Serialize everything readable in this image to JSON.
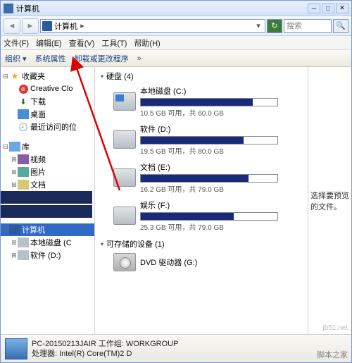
{
  "title": "计算机",
  "address": "计算机",
  "search_placeholder": "搜索",
  "menus": {
    "file": "文件(F)",
    "edit": "编辑(E)",
    "view": "查看(V)",
    "tools": "工具(T)",
    "help": "帮助(H)"
  },
  "toolbar": {
    "organize": "组织 ▾",
    "sysprops": "系统属性",
    "uninstall": "卸载或更改程序",
    "more": "»"
  },
  "tree": {
    "fav": "收藏夹",
    "cc": "Creative Clo",
    "dl": "下载",
    "desktop": "桌面",
    "recent": "最近访问的位",
    "lib": "库",
    "video": "视频",
    "pic": "图片",
    "doc": "文档",
    "computer": "计算机",
    "drvC": "本地磁盘 (C",
    "drvD": "软件 (D:)"
  },
  "groups": {
    "hdd": "硬盘 (4)",
    "removable": "可存储的设备 (1)"
  },
  "drives": [
    {
      "name": "本地磁盘 (C:)",
      "free": "10.5 GB 可用，共 60.0 GB",
      "pct": 82,
      "sys": true
    },
    {
      "name": "软件 (D:)",
      "free": "19.5 GB 可用，共 80.0 GB",
      "pct": 75
    },
    {
      "name": "文档 (E:)",
      "free": "16.2 GB 可用，共 79.0 GB",
      "pct": 79
    },
    {
      "name": "娱乐 (F:)",
      "free": "25.3 GB 可用，共 79.0 GB",
      "pct": 68
    }
  ],
  "dvd": "DVD 驱动器 (G:)",
  "preview": "选择要预览的文件。",
  "status": {
    "l1": "PC-20150213JAIR 工作组: WORKGROUP",
    "l2": "处理器: Intel(R) Core(TM)2 D"
  },
  "watermark1": "jb51.net",
  "watermark2": "脚本之家"
}
